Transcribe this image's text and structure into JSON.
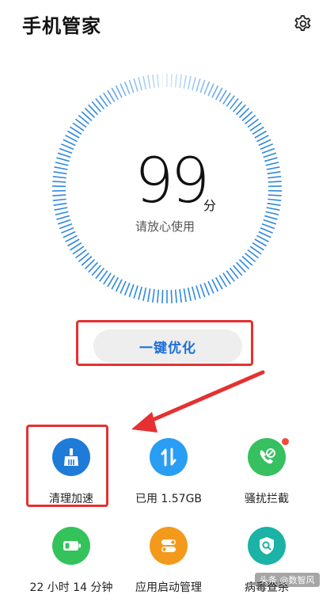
{
  "header": {
    "title": "手机管家",
    "settings_icon": "gear-icon"
  },
  "score_panel": {
    "score": "99",
    "unit": "分",
    "status": "请放心使用",
    "progress_percent": 99
  },
  "optimize": {
    "label": "一键优化"
  },
  "tools": [
    {
      "label": "清理加速",
      "icon": "broom-icon",
      "color": "#1f7bd8"
    },
    {
      "label": "已用 1.57GB",
      "icon": "data-transfer-icon",
      "color": "#2a9df4"
    },
    {
      "label": "骚扰拦截",
      "icon": "phone-block-icon",
      "color": "#36c060",
      "badge": true
    },
    {
      "label": "22 小时 14 分钟",
      "icon": "battery-icon",
      "color": "#34c25a"
    },
    {
      "label": "应用启动管理",
      "icon": "toggle-icon",
      "color": "#f39a1c"
    },
    {
      "label": "病毒查杀",
      "icon": "shield-scan-icon",
      "color": "#1ab3a6"
    }
  ],
  "watermark": "头条 @数智风",
  "colors": {
    "accent": "#1f6fd6",
    "highlight_box": "#e53131",
    "tick_blue": "#2e88e0"
  }
}
